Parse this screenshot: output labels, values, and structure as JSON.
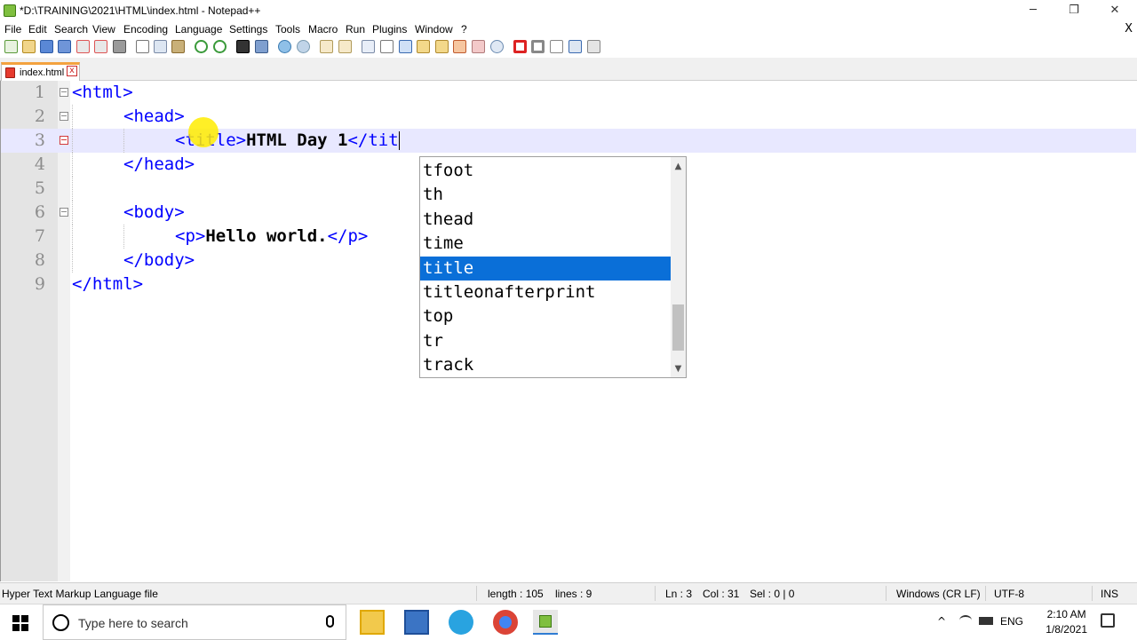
{
  "window": {
    "title": "*D:\\TRAINING\\2021\\HTML\\index.html - Notepad++",
    "minimize": "─",
    "restore": "❐",
    "close": "✕"
  },
  "menubar": {
    "items": [
      "File",
      "Edit",
      "Search",
      "View",
      "Encoding",
      "Language",
      "Settings",
      "Tools",
      "Macro",
      "Run",
      "Plugins",
      "Window",
      "?"
    ],
    "close_glyph": "X"
  },
  "tab": {
    "label": "index.html",
    "close_glyph": "x"
  },
  "editor": {
    "line_numbers": [
      "1",
      "2",
      "3",
      "4",
      "5",
      "6",
      "7",
      "8",
      "9"
    ],
    "lines": {
      "l1": "<html>",
      "l2": "<head>",
      "l3_tag_open": "<title>",
      "l3_text": "HTML Day 1",
      "l3_tag_close": "</tit",
      "l4": "</head>",
      "l6": "<body>",
      "l7_tag_open": "<p>",
      "l7_text": "Hello world.",
      "l7_tag_close": "</p>",
      "l8": "</body>",
      "l9": "</html>"
    }
  },
  "autocomplete": {
    "items": [
      "tfoot",
      "th",
      "thead",
      "time",
      "title",
      "titleonafterprint",
      "top",
      "tr",
      "track"
    ],
    "selected": "title",
    "up_arrow": "▲",
    "down_arrow": "▼"
  },
  "statusbar": {
    "file_type": "Hyper Text Markup Language file",
    "length": "length : 105",
    "lines": "lines : 9",
    "ln": "Ln : 3",
    "col": "Col : 31",
    "sel": "Sel : 0 | 0",
    "eol": "Windows (CR LF)",
    "encoding": "UTF-8",
    "mode": "INS"
  },
  "taskbar": {
    "search_placeholder": "Type here to search",
    "tray_lang": "ENG",
    "time": "2:10 AM",
    "date": "1/8/2021"
  },
  "colors": {
    "tag": "#0000ff",
    "selection": "#0a6fd8",
    "current_line": "#e8e8ff",
    "cursor_highlight": "#ffec00"
  }
}
